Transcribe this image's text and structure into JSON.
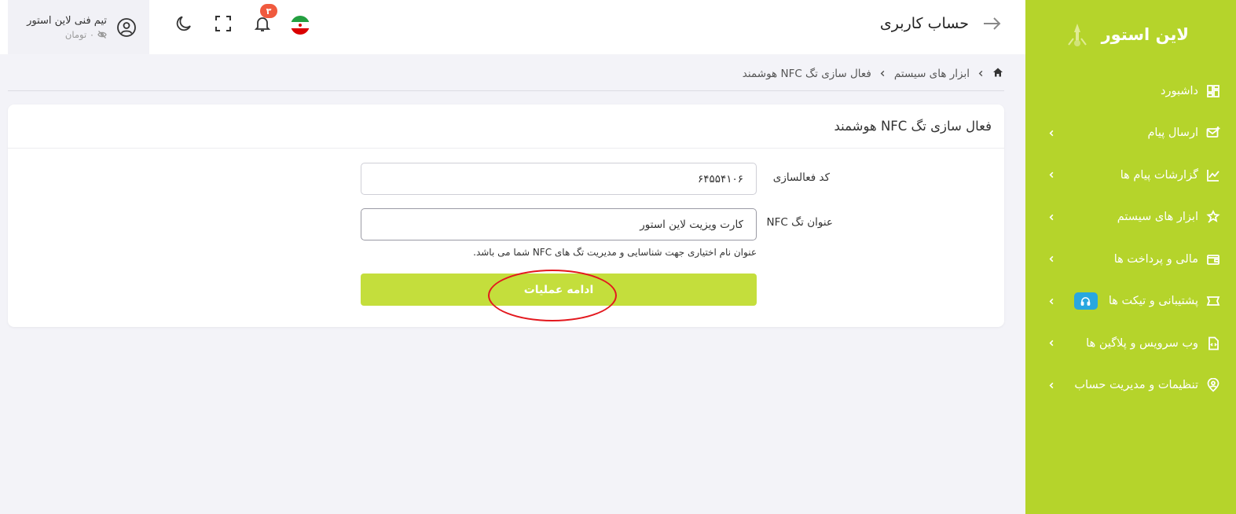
{
  "brand": {
    "name": "لاین استور"
  },
  "sidebar": {
    "items": [
      {
        "label": "داشبورد",
        "icon": "dashboard-icon",
        "has_chevron": false
      },
      {
        "label": "ارسال پیام",
        "icon": "mail-plus-icon",
        "has_chevron": true
      },
      {
        "label": "گزارشات پیام ها",
        "icon": "chart-line-icon",
        "has_chevron": true
      },
      {
        "label": "ابزار های سیستم",
        "icon": "puzzle-icon",
        "has_chevron": true
      },
      {
        "label": "مالی و پرداخت ها",
        "icon": "wallet-icon",
        "has_chevron": true
      },
      {
        "label": "پشتیبانی و تیکت ها",
        "icon": "ticket-icon",
        "has_chevron": true,
        "badge_icon": "headset-icon"
      },
      {
        "label": "وب سرویس و پلاگین ها",
        "icon": "code-file-icon",
        "has_chevron": true
      },
      {
        "label": "تنظیمات و مدیریت حساب",
        "icon": "user-pin-icon",
        "has_chevron": true
      }
    ]
  },
  "header": {
    "title": "حساب کاربری",
    "notifications_count": "۳",
    "user_name": "تیم فنی لاین استور",
    "balance": "۰ تومان"
  },
  "breadcrumb": {
    "items": [
      "ابزار های سیستم",
      "فعال سازی تگ NFC هوشمند"
    ]
  },
  "form": {
    "card_title": "فعال سازی تگ NFC هوشمند",
    "activation_code_label": "کد فعالسازی",
    "activation_code_value": "۶۴۵۵۴۱۰۶",
    "tag_title_label": "عنوان تگ NFC",
    "tag_title_value": "کارت ویزیت لاین استور",
    "tag_title_help": "عنوان نام اختیاری جهت شناسایی و مدیریت تگ های NFC شما می باشد.",
    "submit_label": "ادامه عملیات"
  },
  "colors": {
    "sidebar_bg": "#b5d42b",
    "button_bg": "#c4de3c",
    "badge_red": "#f05a3e",
    "badge_blue": "#28a7e0",
    "annotation_red": "#e3181e"
  }
}
